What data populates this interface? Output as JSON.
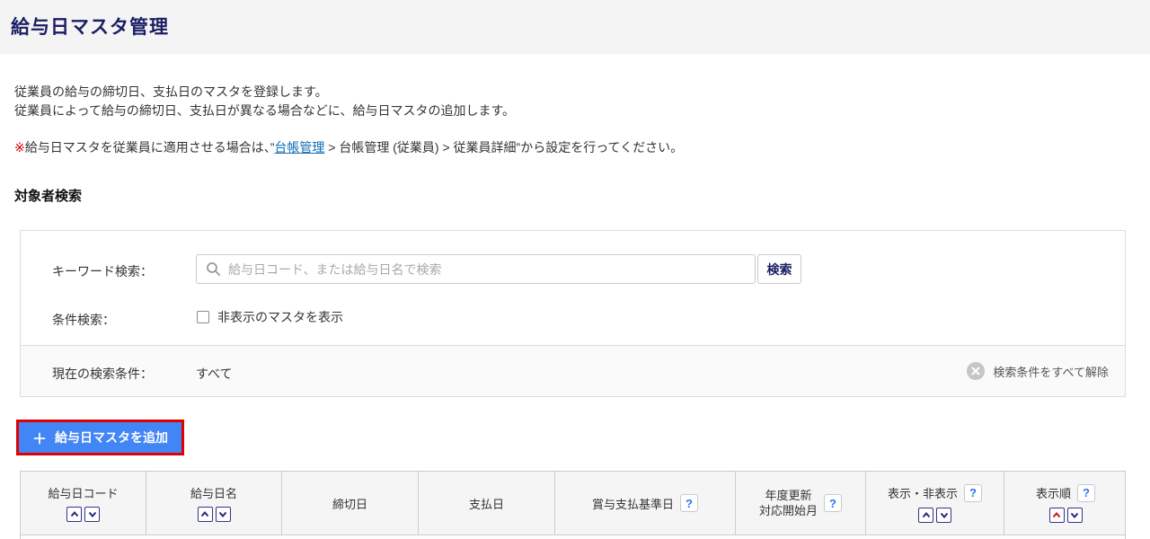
{
  "page": {
    "title": "給与日マスタ管理"
  },
  "intro": {
    "line1": "従業員の給与の締切日、支払日のマスタを登録します。",
    "line2": "従業員によって給与の締切日、支払日が異なる場合などに、給与日マスタの追加します。"
  },
  "note": {
    "asterisk": "※",
    "before_link": "給与日マスタを従業員に適用させる場合は、”",
    "link": "台帳管理",
    "after_link": " > 台帳管理 (従業員) > 従業員詳細”から設定を行ってください。"
  },
  "search_section": {
    "heading": "対象者検索",
    "keyword_label": "キーワード検索：",
    "keyword_placeholder": "給与日コード、または給与日名で検索",
    "keyword_value": "",
    "search_button": "検索",
    "condition_label": "条件検索：",
    "condition_checkbox_label": "非表示のマスタを表示",
    "condition_checkbox_checked": false,
    "current_label": "現在の検索条件：",
    "current_value": "すべて",
    "clear_all_label": "検索条件をすべて解除"
  },
  "add_button": {
    "plus": "＋",
    "label": "給与日マスタを追加"
  },
  "table": {
    "help_glyph": "?",
    "columns": [
      {
        "key": "payday-code",
        "label": "給与日コード",
        "sortable": true,
        "help": false,
        "sort_active": null
      },
      {
        "key": "payday-name",
        "label": "給与日名",
        "sortable": true,
        "help": false,
        "sort_active": null
      },
      {
        "key": "closing-date",
        "label": "締切日",
        "sortable": false,
        "help": false,
        "sort_active": null
      },
      {
        "key": "payment-date",
        "label": "支払日",
        "sortable": false,
        "help": false,
        "sort_active": null
      },
      {
        "key": "bonus-base-date",
        "label": "賞与支払基準日",
        "sortable": false,
        "help": true,
        "sort_active": null
      },
      {
        "key": "annual-update-start-month",
        "label": "年度更新",
        "label2": "対応開始月",
        "sortable": false,
        "help": true,
        "sort_active": null
      },
      {
        "key": "visibility",
        "label": "表示・非表示",
        "sortable": true,
        "help": true,
        "sort_active": null
      },
      {
        "key": "display-order",
        "label": "表示順",
        "sortable": true,
        "help": true,
        "sort_active": "asc"
      }
    ]
  },
  "colors": {
    "title_navy": "#1a1e63",
    "accent_blue": "#4285f4",
    "annotation_red": "#e00000",
    "link_blue": "#0f6db5",
    "help_blue": "#2476e8",
    "sort_navy": "#28287d",
    "sort_active_red": "#c21818",
    "band_gray": "#f4f4f4",
    "table_head_gray": "#f5f5f5"
  }
}
